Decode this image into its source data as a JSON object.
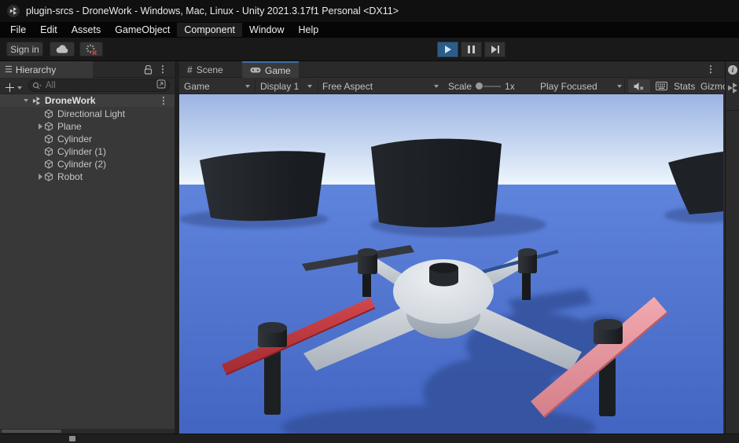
{
  "window": {
    "title": "plugin-srcs - DroneWork - Windows, Mac, Linux - Unity 2021.3.17f1 Personal <DX11>"
  },
  "menu": {
    "items": [
      "File",
      "Edit",
      "Assets",
      "GameObject",
      "Component",
      "Window",
      "Help"
    ]
  },
  "toolbar": {
    "sign_in_label": "Sign in"
  },
  "hierarchy": {
    "tab_label": "Hierarchy",
    "search": {
      "placeholder": "All"
    },
    "scene": {
      "name": "DroneWork"
    },
    "items": [
      {
        "label": "Directional Light",
        "expandable": false
      },
      {
        "label": "Plane",
        "expandable": true
      },
      {
        "label": "Cylinder",
        "expandable": false
      },
      {
        "label": "Cylinder (1)",
        "expandable": false
      },
      {
        "label": "Cylinder (2)",
        "expandable": false
      },
      {
        "label": "Robot",
        "expandable": true
      }
    ]
  },
  "game_panel": {
    "tabs": {
      "scene": "Scene",
      "game": "Game"
    },
    "controls": {
      "display_target": "Game",
      "display": "Display 1",
      "aspect": "Free Aspect",
      "scale_label": "Scale",
      "scale_value": "1x",
      "focus_mode": "Play Focused",
      "stats_label": "Stats",
      "gizmos_label": "Gizmos"
    }
  },
  "colors": {
    "accent_play_bg": "#2c5d87",
    "tab_active_line": "#3e6fa8",
    "sky_top": "#9cb4e4",
    "sky_mid": "#c6d7f0",
    "sky_horizon": "#edf5fc",
    "ground_top": "#5f84dc",
    "ground_bottom": "#4365c2",
    "cylinder_dark": "#191c20",
    "cylinder_light": "#2a2f35",
    "shadow_blue": "#4462ac",
    "drone_shadow": "#36539f",
    "body_light": "#eceff2",
    "body_mid": "#c8cfd6",
    "body_under": "#98a2ae",
    "prop_red": "#d2474d",
    "prop_red_dark": "#a32b31",
    "prop_pink": "#f2a9b0",
    "prop_pink_dark": "#d47f89",
    "prop_gray": "#34383d",
    "prop_blue": "#2e5192",
    "motor_black": "#17191c"
  }
}
